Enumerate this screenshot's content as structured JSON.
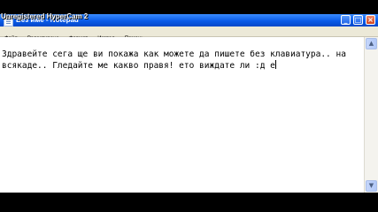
{
  "watermark": {
    "text": "Unregistered HyperCam 2"
  },
  "window": {
    "title": "Без име - Notepad",
    "buttons": {
      "minimize": "_",
      "maximize": "□",
      "close": "×"
    }
  },
  "menu": {
    "items": [
      "Файл",
      "Редактиране",
      "Формат",
      "Изглед",
      "Помощ"
    ]
  },
  "editor": {
    "text": "Здравейте сега ще ви покажа как можете да пишете без клавиатура.. на всякаде.. Гледайте ме какво правя! ето виждате ли :д е"
  },
  "scrollbar": {
    "up_glyph": "▲",
    "down_glyph": "▼"
  }
}
